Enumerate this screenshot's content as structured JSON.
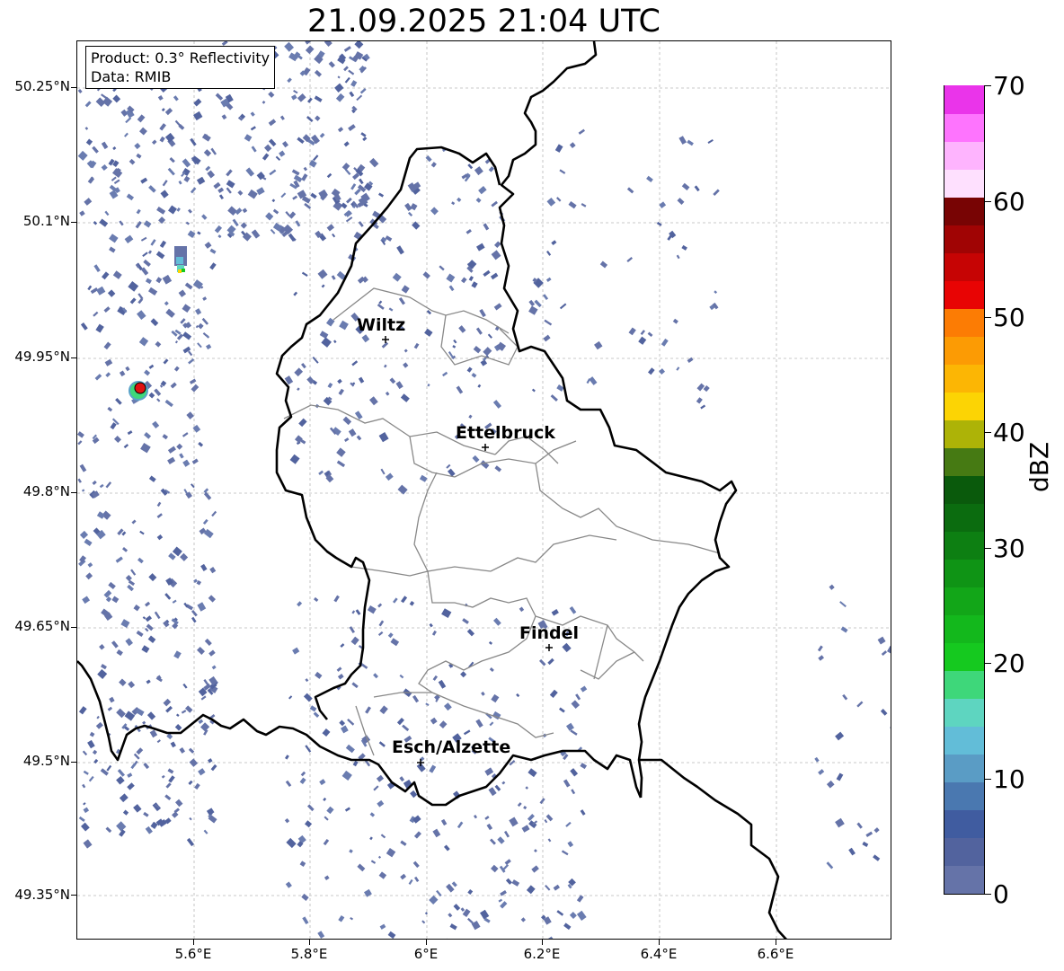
{
  "title": "21.09.2025 21:04 UTC",
  "info": {
    "product": "Product: 0.3° Reflectivity",
    "data": "Data: RMIB"
  },
  "lat_labels": [
    "50.25°N",
    "50.1°N",
    "49.95°N",
    "49.8°N",
    "49.65°N",
    "49.5°N",
    "49.35°N"
  ],
  "lon_labels": [
    "5.6°E",
    "5.8°E",
    "6°E",
    "6.2°E",
    "6.4°E",
    "6.6°E"
  ],
  "cities": [
    "Wiltz",
    "Ettelbruck",
    "Findel",
    "Esch/Alzette"
  ],
  "colorbar": {
    "label": "dBZ",
    "ticks": [
      "70",
      "60",
      "50",
      "40",
      "30",
      "20",
      "10",
      "0"
    ],
    "colors": [
      "#6573a8",
      "#52639e",
      "#405ca0",
      "#4a78b0",
      "#5a9cc5",
      "#62bdd8",
      "#5ed5c0",
      "#3ed77a",
      "#15c91f",
      "#13b81c",
      "#12a618",
      "#0f9415",
      "#0d7f12",
      "#0b6c0f",
      "#0a5a0c",
      "#467a13",
      "#adb307",
      "#fcd404",
      "#fcb604",
      "#fc9b04",
      "#fc7c04",
      "#e80404",
      "#c60404",
      "#a00404",
      "#780404",
      "#fee0fe",
      "#feb4fe",
      "#fe74fe",
      "#ea34ea"
    ]
  },
  "radar_site_color": "#e01010"
}
